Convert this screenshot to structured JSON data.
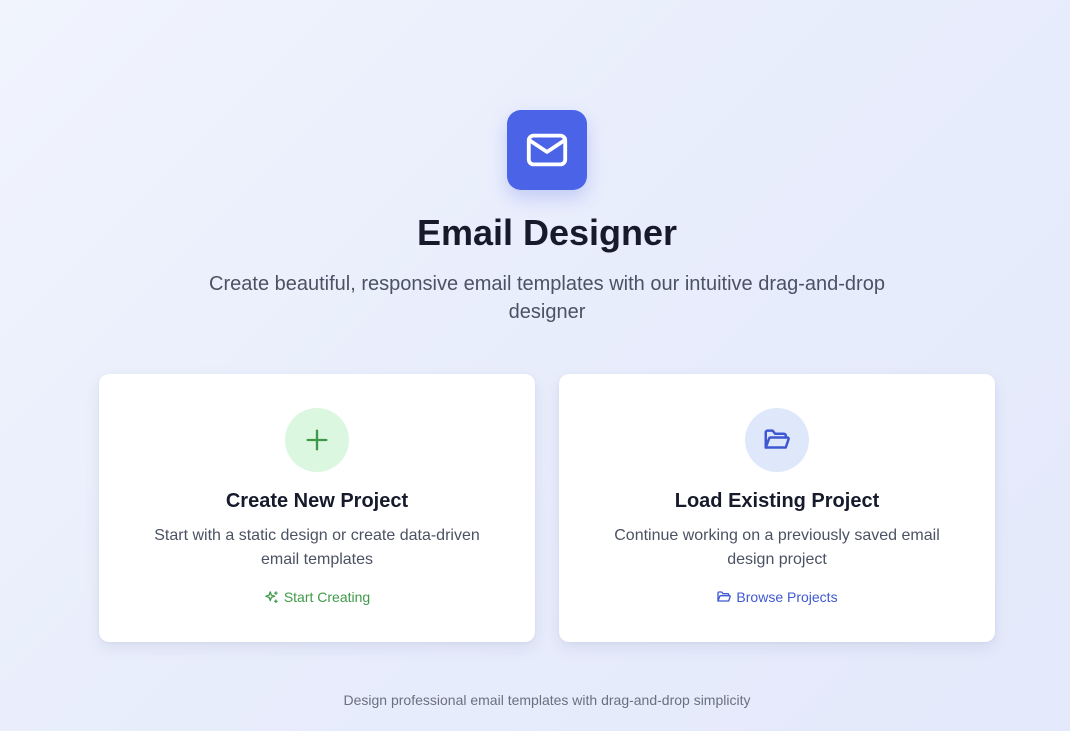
{
  "header": {
    "logo_icon": "mail-icon",
    "title": "Email Designer",
    "subtitle": "Create beautiful, responsive email templates with our intuitive drag-and-drop designer"
  },
  "cards": [
    {
      "icon": "plus-icon",
      "title": "Create New Project",
      "description": "Start with a static design or create data-driven email templates",
      "action_icon": "sparkles-icon",
      "action_label": "Start Creating",
      "accent_color": "#3f9a48",
      "icon_bg": "#dcf7df"
    },
    {
      "icon": "folder-open-icon",
      "title": "Load Existing Project",
      "description": "Continue working on a previously saved email design project",
      "action_icon": "folder-open-icon",
      "action_label": "Browse Projects",
      "accent_color": "#3f58d2",
      "icon_bg": "#dfe8fb"
    }
  ],
  "footer": {
    "text": "Design professional email templates with drag-and-drop simplicity"
  },
  "colors": {
    "brand": "#4a63e7",
    "heading": "#161a2b",
    "body_text": "#4b5263",
    "muted_text": "#6a7080"
  }
}
